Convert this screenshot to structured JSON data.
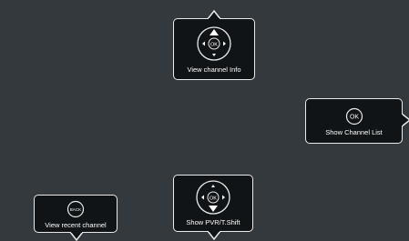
{
  "screen": {
    "background": "#34393d",
    "hints": {
      "top": {
        "label": "View channel Info",
        "icon": "remote-dpad-up"
      },
      "right": {
        "label": "Show Channel List",
        "icon": "ok-button"
      },
      "bottom": {
        "label": "Show PVR/T.Shift",
        "icon": "remote-dpad-down"
      },
      "left": {
        "label": "View recent channel",
        "icon": "back-button"
      }
    },
    "button_texts": {
      "ok": "OK",
      "back": "BACK"
    }
  }
}
